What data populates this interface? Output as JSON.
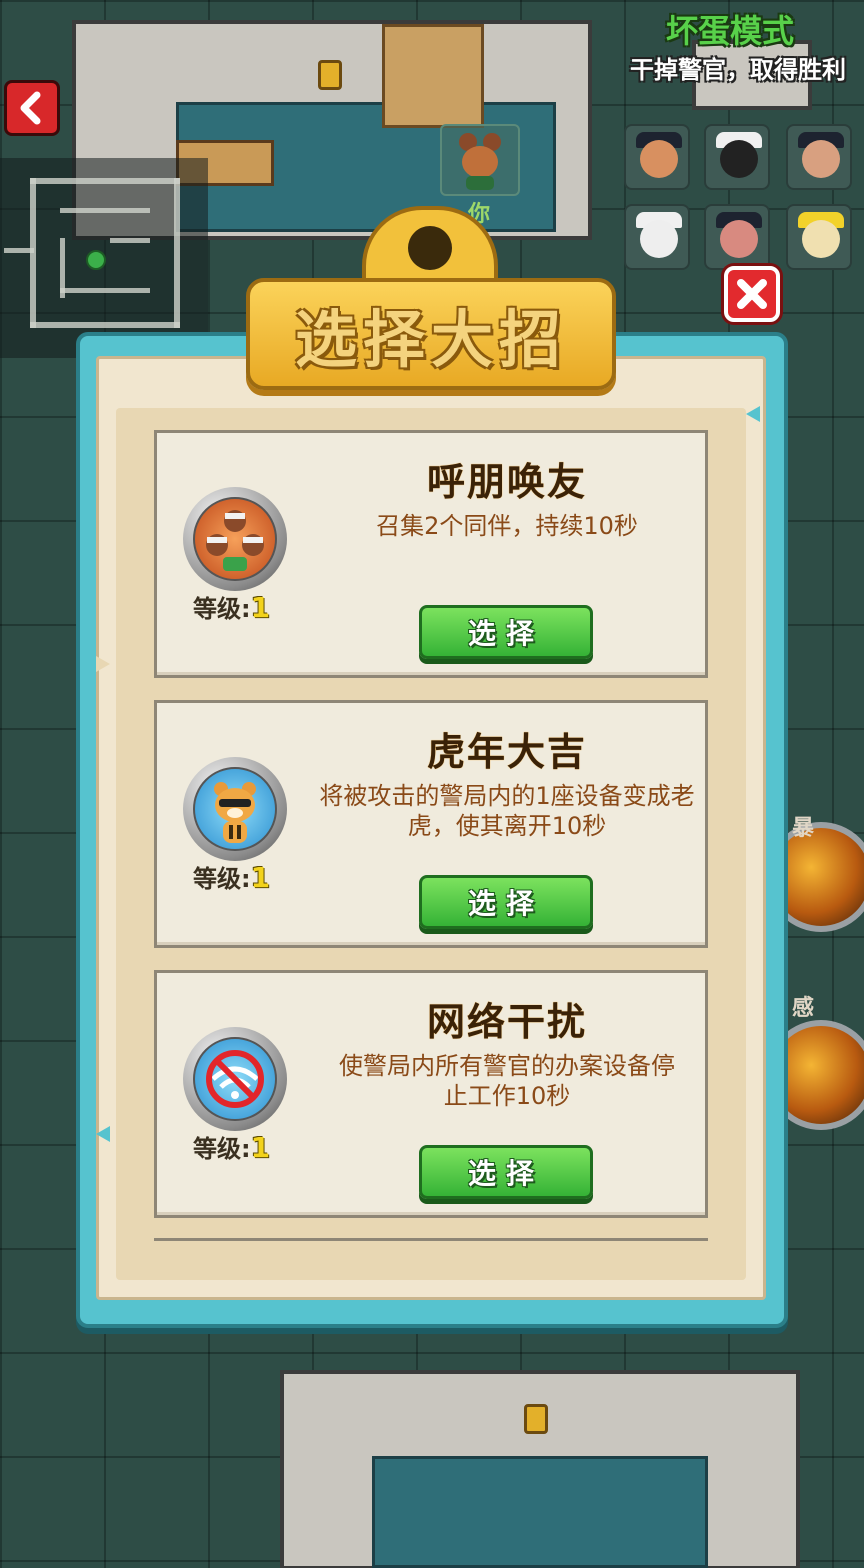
{
  "hud": {
    "mode_title": "坏蛋模式",
    "mode_subtitle": "干掉警官，取得胜利",
    "you_label": "你"
  },
  "dialog": {
    "title": "选择大招",
    "skills": [
      {
        "name": "呼朋唤友",
        "description": "召集2个同伴，持续10秒",
        "level_label": "等级:",
        "level": "1",
        "select_label": "选择",
        "icon": "friends-icon"
      },
      {
        "name": "虎年大吉",
        "description": "将被攻击的警局内的1座设备变成老虎，使其离开10秒",
        "level_label": "等级:",
        "level": "1",
        "select_label": "选择",
        "icon": "tiger-icon"
      },
      {
        "name": "网络干扰",
        "description": "使警局内所有警官的办案设备停止工作10秒",
        "level_label": "等级:",
        "level": "1",
        "select_label": "选择",
        "icon": "no-wifi-icon"
      }
    ]
  },
  "side_orbs": [
    {
      "label": "暴"
    },
    {
      "label": "感"
    }
  ],
  "colors": {
    "clipboard": "#56c3cf",
    "paper": "#f1e6cf",
    "select_button": "#35b336",
    "title_plate": "#f2c13b",
    "close_button": "#e22a2e",
    "mode_title": "#58d14a"
  }
}
